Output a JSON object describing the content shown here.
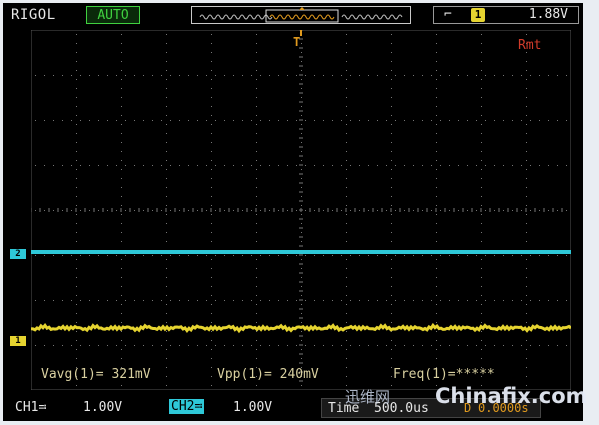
{
  "header": {
    "brand": "RIGOL",
    "mode": "AUTO",
    "trigger_edge_symbol": "⌐",
    "trigger_source": "1",
    "trigger_level": "1.88V"
  },
  "screen": {
    "remote_label": "Rmt",
    "trigger_position_marker": "T"
  },
  "channels": {
    "ch2_marker": "2",
    "ch1_marker": "1",
    "ch2_color": "#2ec8d8",
    "ch1_color": "#e6d430"
  },
  "measurements": {
    "vavg": "Vavg(1)= 321mV",
    "vpp": "Vpp(1)= 240mV",
    "freq": "Freq(1)=*****"
  },
  "footer": {
    "ch1_label": "CH1≕",
    "ch1_scale": "1.00V",
    "ch2_label": "CH2≕",
    "ch2_scale": "1.00V",
    "time_label": "Time",
    "time_scale": "500.0us",
    "trig_marker": "D",
    "trig_offset": "0.0000s"
  },
  "watermark": {
    "text_cn": "迅维网",
    "text_en": "Chinafix.com"
  }
}
